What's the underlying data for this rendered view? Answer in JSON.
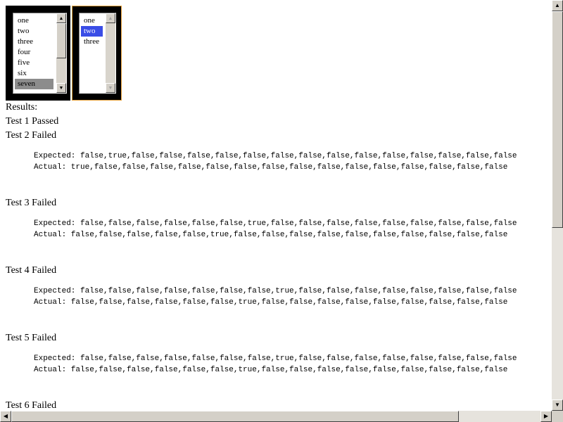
{
  "listbox1": {
    "items": [
      "one",
      "two",
      "three",
      "four",
      "five",
      "six",
      "seven"
    ],
    "selected": "seven"
  },
  "listbox2": {
    "items": [
      "one",
      "two",
      "three"
    ],
    "selected": "two"
  },
  "scroll_arrows": {
    "up": "▲",
    "down": "▼",
    "left": "◀",
    "right": "▶"
  },
  "results": {
    "heading": "Results:",
    "tests": [
      {
        "title": "Test 1 Passed"
      },
      {
        "title": "Test 2 Failed",
        "expected": "Expected: false,true,false,false,false,false,false,false,false,false,false,false,false,false,false,false",
        "actual": "Actual: true,false,false,false,false,false,false,false,false,false,false,false,false,false,false,false"
      },
      {
        "title": "Test 3 Failed",
        "expected": "Expected: false,false,false,false,false,false,true,false,false,false,false,false,false,false,false,false",
        "actual": "Actual: false,false,false,false,false,true,false,false,false,false,false,false,false,false,false,false"
      },
      {
        "title": "Test 4 Failed",
        "expected": "Expected: false,false,false,false,false,false,false,true,false,false,false,false,false,false,false,false",
        "actual": "Actual: false,false,false,false,false,false,true,false,false,false,false,false,false,false,false,false"
      },
      {
        "title": "Test 5 Failed",
        "expected": "Expected: false,false,false,false,false,false,false,true,false,false,false,false,false,false,false,false",
        "actual": "Actual: false,false,false,false,false,false,true,false,false,false,false,false,false,false,false,false"
      },
      {
        "title": "Test 6 Failed"
      }
    ]
  },
  "colors": {
    "listbox2_focus_border": "#e8a33c",
    "selected_blue": "#3a4de6",
    "selected_grey": "#8c8c8c"
  }
}
